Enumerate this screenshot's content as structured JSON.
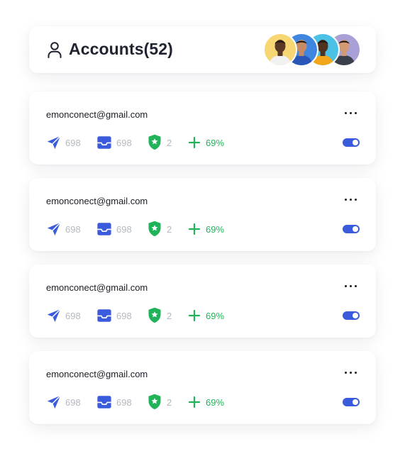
{
  "header": {
    "title": "Accounts(52)",
    "icon": "user-icon",
    "avatars": [
      {
        "bg": "#f6d774",
        "skin": "#5a3826",
        "shirt": "#f2f2f2"
      },
      {
        "bg": "#3f86e0",
        "skin": "#c88a63",
        "shirt": "#2a56b8"
      },
      {
        "bg": "#4cc1e6",
        "skin": "#4f3220",
        "shirt": "#f2a71b"
      },
      {
        "bg": "#a9a0d8",
        "skin": "#d19a72",
        "shirt": "#3a3f4c"
      }
    ]
  },
  "accounts": [
    {
      "email": "emonconect@gmail.com",
      "sent": "698",
      "inbox": "698",
      "verified": "2",
      "growth": "69%",
      "enabled": true
    },
    {
      "email": "emonconect@gmail.com",
      "sent": "698",
      "inbox": "698",
      "verified": "2",
      "growth": "69%",
      "enabled": true
    },
    {
      "email": "emonconect@gmail.com",
      "sent": "698",
      "inbox": "698",
      "verified": "2",
      "growth": "69%",
      "enabled": true
    },
    {
      "email": "emonconect@gmail.com",
      "sent": "698",
      "inbox": "698",
      "verified": "2",
      "growth": "69%",
      "enabled": true
    }
  ],
  "colors": {
    "accent": "#3a5bdc",
    "success": "#22b35a",
    "muted": "#b4b8c0",
    "text": "#1a1d24"
  }
}
